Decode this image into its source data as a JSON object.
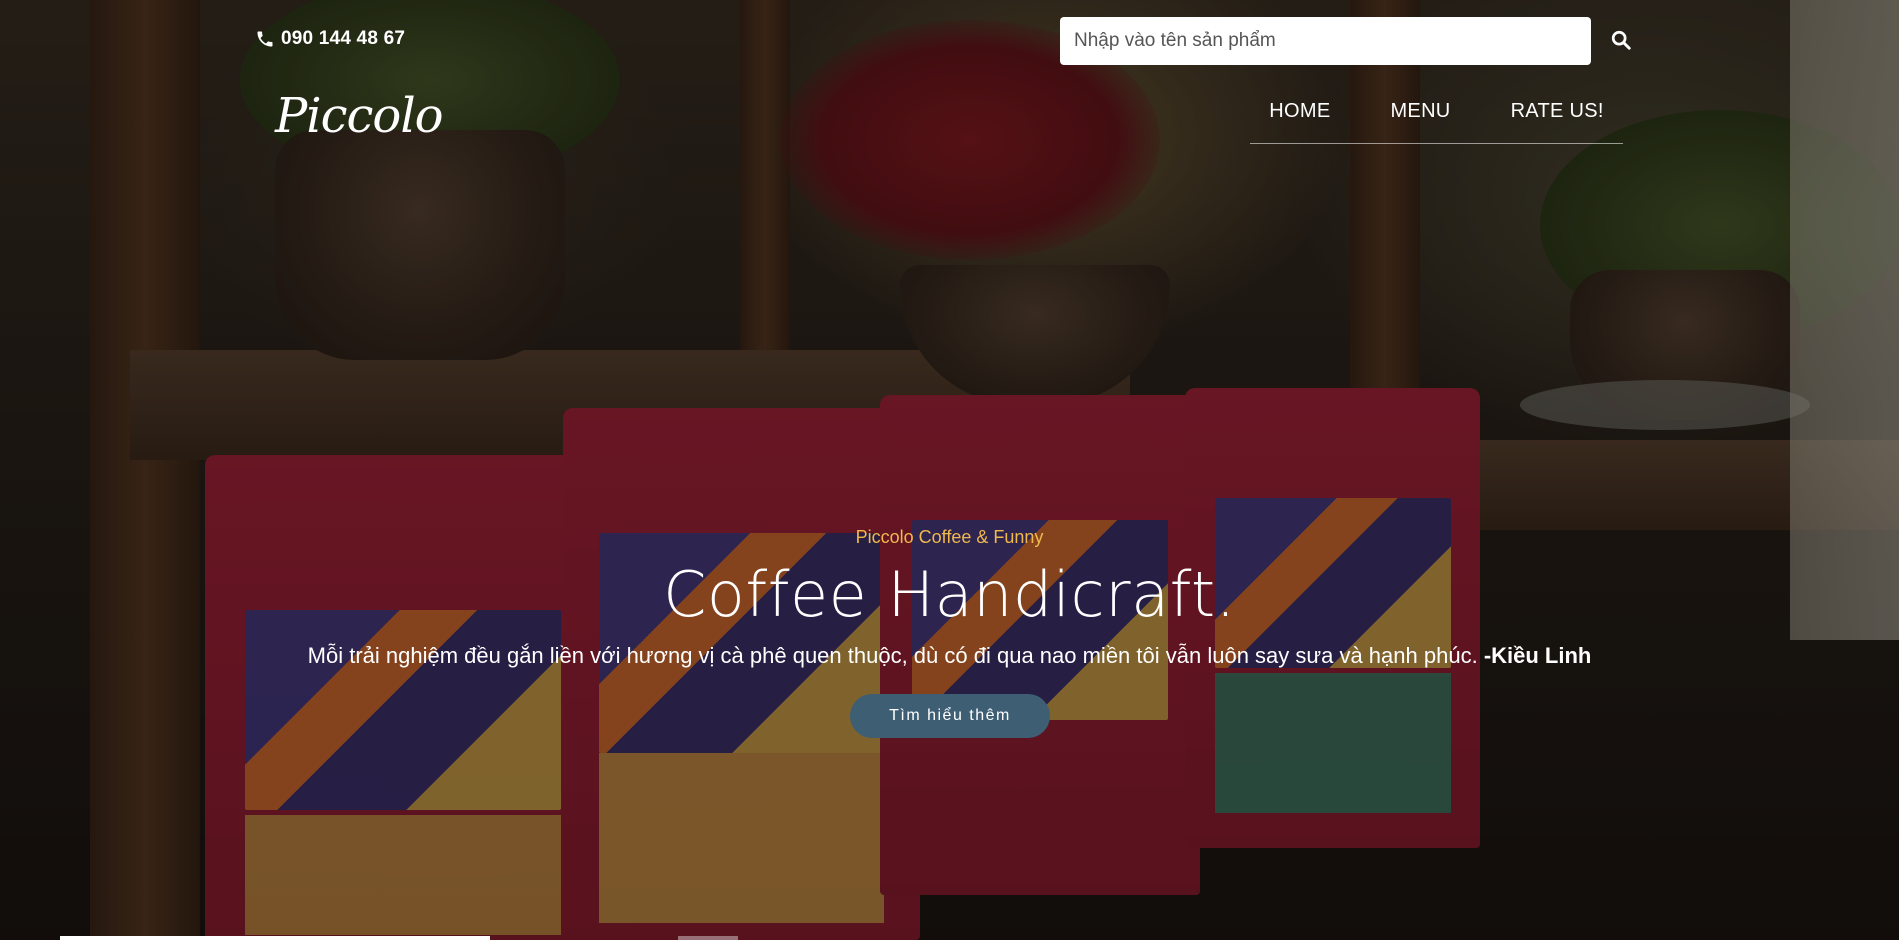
{
  "topbar": {
    "phone_icon": "phone-icon",
    "phone": "090 144 48 67"
  },
  "search": {
    "placeholder": "Nhập vào tên sản phẩm",
    "value": "",
    "button_icon": "search-icon"
  },
  "brand": {
    "logo": "Piccolo"
  },
  "nav": {
    "items": [
      {
        "label": "HOME"
      },
      {
        "label": "MENU"
      },
      {
        "label": "RATE US!"
      }
    ]
  },
  "hero": {
    "kicker": "Piccolo Coffee & Funny",
    "headline": "Coffee Handicraft.",
    "quote": "Mỗi trải nghiệm đều gắn liền với hương vị cà phê quen thuộc, dù có đi qua nao miền tôi vẫn luôn say sưa và hạnh phúc.",
    "quote_author": "-Kiều Linh",
    "cta": "Tìm hiểu thêm",
    "kicker_color": "#f0b84d",
    "cta_color": "#3e5e74"
  }
}
